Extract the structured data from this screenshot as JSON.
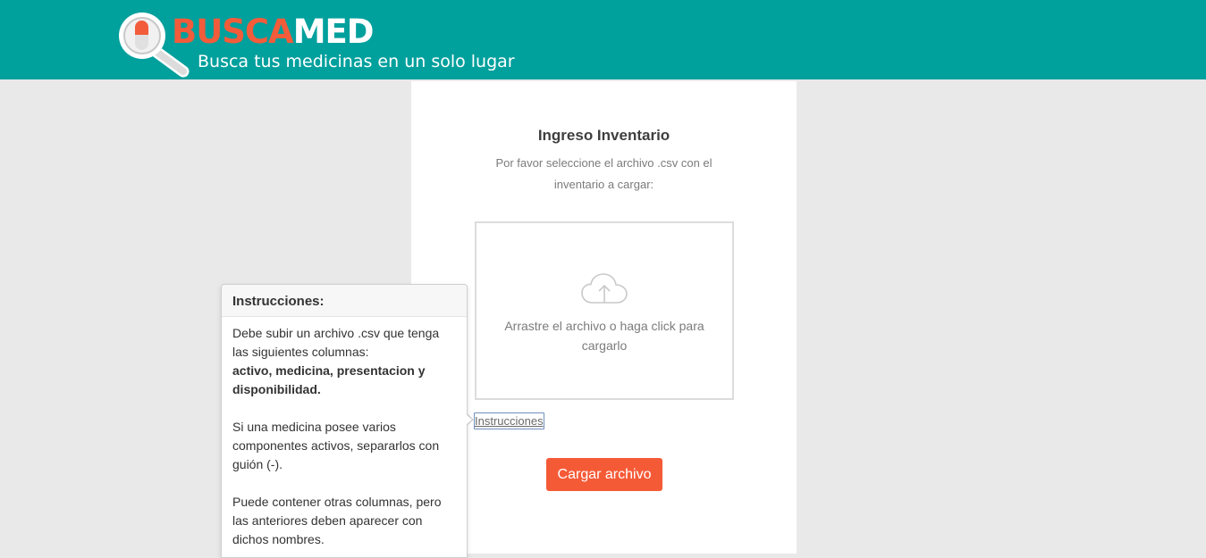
{
  "brand": {
    "name_part1": "BUSCA",
    "name_part2": "MED",
    "tagline": "Busca tus medicinas en un solo lugar",
    "logo_icon": "magnifier-pill-icon",
    "colors": {
      "header": "#00a09d",
      "accent": "#f35c3a"
    }
  },
  "upload": {
    "title": "Ingreso Inventario",
    "subtitle": "Por favor seleccione el archivo .csv con el inventario a cargar:",
    "dropzone_icon": "cloud-upload-icon",
    "dropzone_text": "Arrastre el archivo o haga click para cargarlo",
    "instructions_link": "Instrucciones",
    "submit_label": "Cargar archivo",
    "submit_color": "#f55a37"
  },
  "popover": {
    "title": "Instrucciones:",
    "p1": "Debe subir un archivo .csv que tenga las siguientes columnas:",
    "p1_bold": "activo, medicina, presentacion y disponibilidad.",
    "p2": "Si una medicina posee varios componentes activos, separarlos con guión (-).",
    "p3": "Puede contener otras columnas, pero las anteriores deben aparecer con dichos nombres."
  }
}
